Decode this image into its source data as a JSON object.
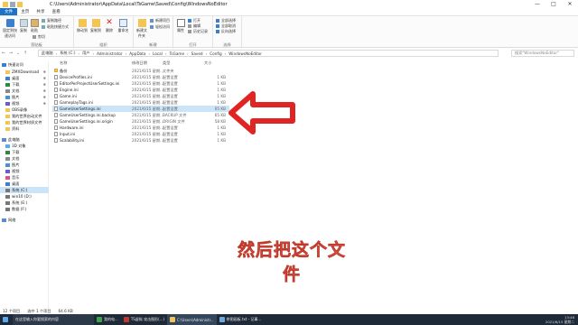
{
  "window": {
    "title": "C:\\Users\\Administrator\\AppData\\Local\\TsGame\\Saved\\Config\\WindowsNoEditor",
    "controls": [
      "—",
      "□",
      "✕"
    ]
  },
  "menu": [
    "文件",
    "主页",
    "共享",
    "查看"
  ],
  "ribbon": {
    "pin_quick_access": "固定到快速访问",
    "copy": "复制",
    "paste": "粘贴",
    "copy_path": "复制路径",
    "paste_shortcut": "粘贴快捷方式",
    "cut": "剪切",
    "clipboard_group": "剪贴板",
    "move_to": "移动到",
    "copy_to": "复制到",
    "delete": "删除",
    "rename": "重命名",
    "organize_group": "组织",
    "new_folder": "新建文件夹",
    "new_item": "新建项目",
    "easy_access": "轻松访问",
    "new_group": "新建",
    "properties": "属性",
    "open": "打开",
    "edit": "编辑",
    "history": "历史记录",
    "open_group": "打开",
    "select_all": "全部选择",
    "select_none": "全部取消",
    "invert_selection": "反向选择",
    "select_group": "选择"
  },
  "address": {
    "crumbs": [
      "此电脑",
      "系统 (C:)",
      "用户",
      "Administrator",
      "AppData",
      "Local",
      "TsGame",
      "Saved",
      "Config",
      "WindowsNoEditor"
    ],
    "search_placeholder": "搜索\"WindowsNoEditor\""
  },
  "sidebar": {
    "items": [
      {
        "label": "快速访问",
        "pinned": false
      },
      {
        "label": "ZMXDownload",
        "pinned": true
      },
      {
        "label": "桌面",
        "pinned": true
      },
      {
        "label": "下载",
        "pinned": true
      },
      {
        "label": "文档",
        "pinned": true
      },
      {
        "label": "图片",
        "pinned": true
      },
      {
        "label": "视频",
        "pinned": true
      },
      {
        "label": "OBS录像",
        "pinned": false
      },
      {
        "label": "我的世界启动文件",
        "pinned": false
      },
      {
        "label": "我的世界材质文件",
        "pinned": false
      },
      {
        "label": "资料",
        "pinned": false
      },
      {
        "label": "此电脑",
        "pinned": false
      },
      {
        "label": "3D 对象",
        "pinned": false
      },
      {
        "label": "下载",
        "pinned": false
      },
      {
        "label": "文档",
        "pinned": false
      },
      {
        "label": "图片",
        "pinned": false
      },
      {
        "label": "视频",
        "pinned": false
      },
      {
        "label": "音乐",
        "pinned": false
      },
      {
        "label": "桌面",
        "pinned": false
      },
      {
        "label": "系统 (C:)",
        "pinned": false
      },
      {
        "label": "win10 (D:)",
        "pinned": false
      },
      {
        "label": "系统 (E:)",
        "pinned": false
      },
      {
        "label": "数据 (F:)",
        "pinned": false
      },
      {
        "label": "网络",
        "pinned": false
      }
    ]
  },
  "columns": {
    "name": "名称",
    "date": "修改日期",
    "type": "类型",
    "size": "大小"
  },
  "files": [
    {
      "name": "备份",
      "date": "2021/6/15 星期...",
      "type": "文件夹",
      "size": "",
      "folder": true
    },
    {
      "name": "DeviceProfiles.ini",
      "date": "2021/6/15 星期...",
      "type": "配置设置",
      "size": "1 KB"
    },
    {
      "name": "EditorPerProjectUserSettings.ini",
      "date": "2021/6/15 星期...",
      "type": "配置设置",
      "size": "1 KB"
    },
    {
      "name": "Engine.ini",
      "date": "2021/6/15 星期...",
      "type": "配置设置",
      "size": "1 KB"
    },
    {
      "name": "Game.ini",
      "date": "2021/6/15 星期...",
      "type": "配置设置",
      "size": "1 KB"
    },
    {
      "name": "GameplayTags.ini",
      "date": "2021/6/15 星期...",
      "type": "配置设置",
      "size": "1 KB"
    },
    {
      "name": "GameUserSettings.ini",
      "date": "2021/6/15 星期...",
      "type": "配置设置",
      "size": "65 KB",
      "selected": true
    },
    {
      "name": "GameUserSettings.ini.backup",
      "date": "2021/6/15 星期...",
      "type": "BACKUP 文件",
      "size": "65 KB"
    },
    {
      "name": "GameUserSettings.ini.origin",
      "date": "2021/6/15 星期...",
      "type": "ORIGIN 文件",
      "size": "58 KB"
    },
    {
      "name": "Hardware.ini",
      "date": "2021/6/15 星期...",
      "type": "配置设置",
      "size": "1 KB"
    },
    {
      "name": "Input.ini",
      "date": "2021/6/15 星期...",
      "type": "配置设置",
      "size": "1 KB"
    },
    {
      "name": "Scalability.ini",
      "date": "2021/6/15 星期...",
      "type": "配置设置",
      "size": "1 KB"
    }
  ],
  "status": {
    "count": "12 个项目",
    "selection": "选中 1 个项目",
    "size": "64.6 KB"
  },
  "subtitle": "然后把这个文件",
  "taskbar": {
    "items": [
      "在这里输入你要搜索的内容",
      "我的电...",
      "TS虚拟 攻击图形(...)",
      "C:\\Users\\Administr...",
      "拼图画板.txt - 记事..."
    ],
    "time": "13:46",
    "date": "2021/6/15 星期二"
  },
  "colors": {
    "accent": "#1a73c8",
    "selection": "#cce4f7",
    "arrow": "#e02424",
    "subtitle": "#f5a8a8"
  }
}
